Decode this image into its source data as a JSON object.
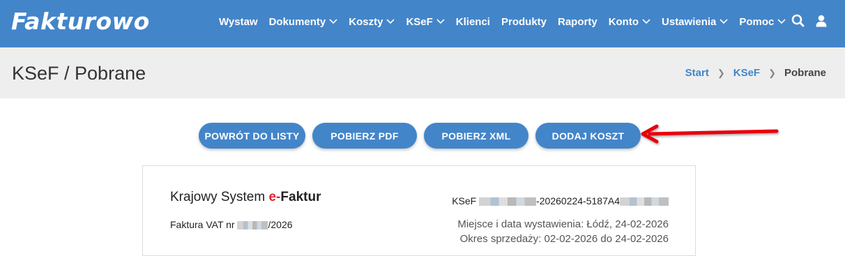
{
  "app": {
    "logo": "Fakturowo"
  },
  "nav": {
    "items": [
      {
        "label": "Wystaw",
        "dropdown": false
      },
      {
        "label": "Dokumenty",
        "dropdown": true
      },
      {
        "label": "Koszty",
        "dropdown": true
      },
      {
        "label": "KSeF",
        "dropdown": true
      },
      {
        "label": "Klienci",
        "dropdown": false
      },
      {
        "label": "Produkty",
        "dropdown": false
      },
      {
        "label": "Raporty",
        "dropdown": false
      },
      {
        "label": "Konto",
        "dropdown": true
      },
      {
        "label": "Ustawienia",
        "dropdown": true
      },
      {
        "label": "Pomoc",
        "dropdown": true
      }
    ],
    "icons": [
      "search-icon",
      "user-icon"
    ]
  },
  "header": {
    "title": "KSeF / Pobrane",
    "breadcrumb": {
      "start": "Start",
      "section": "KSeF",
      "current": "Pobrane"
    }
  },
  "actions": {
    "back": "POWRÓT DO LISTY",
    "pdf": "POBIERZ PDF",
    "xml": "POBIERZ XML",
    "add_cost": "DODAJ KOSZT"
  },
  "invoice": {
    "system_title_prefix": "Krajowy System ",
    "system_title_e": "e-",
    "system_title_suffix": "Faktur",
    "number_prefix": "Faktura VAT nr ",
    "number_suffix": "/2026",
    "ksef_prefix": "KSeF ",
    "ksef_visible": "-20260224-5187A4",
    "place_date": "Miejsce i data wystawienia: Łódź, 24-02-2026",
    "period": "Okres sprzedaży: 02-02-2026 do 24-02-2026"
  },
  "colors": {
    "primary": "#4385c9",
    "header_bg": "#eeeeee",
    "accent_red": "#e0262f",
    "arrow": "#e8000b"
  }
}
